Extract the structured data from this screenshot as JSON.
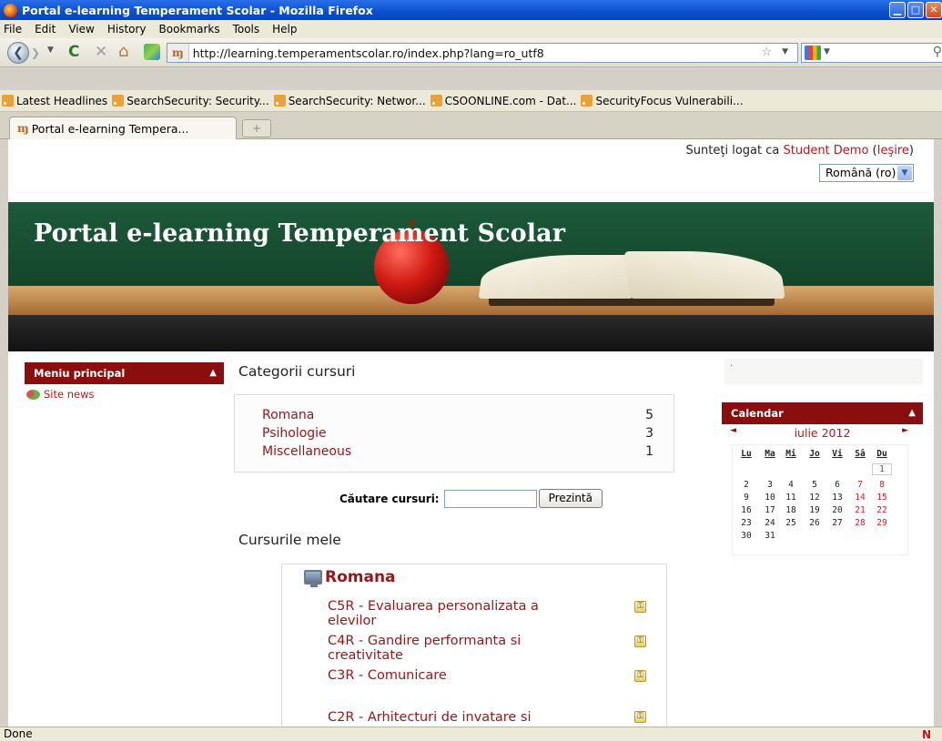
{
  "window": {
    "title": "Portal e-learning Temperament Scolar - Mozilla Firefox"
  },
  "menu": [
    "File",
    "Edit",
    "View",
    "History",
    "Bookmarks",
    "Tools",
    "Help"
  ],
  "address": {
    "site_icon": "ɱ",
    "url": "http://learning.temperamentscolar.ro/index.php?lang=ro_utf8"
  },
  "bookmarks": [
    "Latest Headlines",
    "SearchSecurity: Security...",
    "SearchSecurity: Networ...",
    "CSOONLINE.com - Dat...",
    "SecurityFocus Vulnerabili..."
  ],
  "tab": {
    "icon": "ɱ",
    "label": "Portal e-learning Tempera...",
    "new_tab": "+"
  },
  "page": {
    "login_prefix": "Sunteţi logat ca",
    "user_name": "Student Demo",
    "logout_label": "Ieşire",
    "language": "Română (ro)",
    "banner_title": "Portal e-learning Temperament Scolar"
  },
  "left_block": {
    "title": "Meniu principal",
    "items": [
      {
        "label": "Site news",
        "icon": "news-icon"
      }
    ]
  },
  "categories": {
    "heading": "Categorii cursuri",
    "items": [
      {
        "name": "Romana",
        "count": "5"
      },
      {
        "name": "Psihologie",
        "count": "3"
      },
      {
        "name": "Miscellaneous",
        "count": "1"
      }
    ]
  },
  "search": {
    "label": "Căutare cursuri:",
    "value": "",
    "button": "Prezintă"
  },
  "my_courses": {
    "heading": "Cursurile mele",
    "category": "Romana",
    "items": [
      {
        "line1": "C5R - Evaluarea personalizata a",
        "line2": "elevilor"
      },
      {
        "line1": "C4R - Gandire performanta si",
        "line2": "creativitate"
      },
      {
        "line1": "C3R - Comunicare",
        "line2": ""
      },
      {
        "line1": "C2R - Arhitecturi de invatare si",
        "line2": ""
      }
    ]
  },
  "right_top": {
    "text": "."
  },
  "calendar": {
    "title": "Calendar",
    "month": "iulie 2012",
    "prev": "◄",
    "next": "►",
    "days": [
      "Lu",
      "Ma",
      "Mi",
      "Jo",
      "Vi",
      "Sâ",
      "Du"
    ],
    "weeks": [
      [
        "",
        "",
        "",
        "",
        "",
        "",
        "1"
      ],
      [
        "2",
        "3",
        "4",
        "5",
        "6",
        "7",
        "8"
      ],
      [
        "9",
        "10",
        "11",
        "12",
        "13",
        "14",
        "15"
      ],
      [
        "16",
        "17",
        "18",
        "19",
        "20",
        "21",
        "22"
      ],
      [
        "23",
        "24",
        "25",
        "26",
        "27",
        "28",
        "29"
      ],
      [
        "30",
        "31",
        "",
        "",
        "",
        "",
        ""
      ]
    ]
  },
  "status": {
    "text": "Done"
  },
  "colors": {
    "accent": "#8b0e0e",
    "link": "#9c1414",
    "weekend": "#c8242b"
  }
}
